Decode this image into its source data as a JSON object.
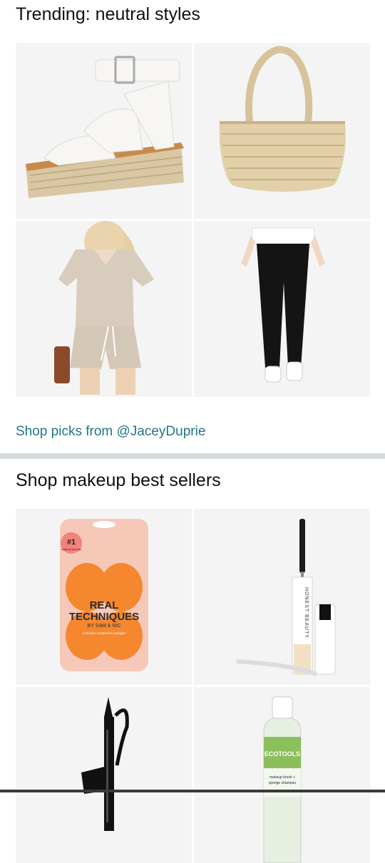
{
  "trending": {
    "title": "Trending: neutral styles",
    "tiles": [
      {
        "name": "White platform espadrille sandals"
      },
      {
        "name": "Woven straw tote bag"
      },
      {
        "name": "Beige waffle knit shorts set"
      },
      {
        "name": "Black leggings"
      }
    ],
    "link_text": "Shop picks from @JaceyDuprie"
  },
  "makeup": {
    "title": "Shop makeup best sellers",
    "tiles": [
      {
        "name": "Real Techniques makeup sponges",
        "badge": "#1",
        "badge_sub": "makeup sponge",
        "brand_line1": "REAL",
        "brand_line2": "TECHNIQUES",
        "brand_sub": "BY SAM & NIC",
        "pack_note": "4 miracle complexion sponges"
      },
      {
        "name": "Honest Beauty mascara",
        "brand": "HONEST BEAUTY"
      },
      {
        "name": "Black liquid eyeliner"
      },
      {
        "name": "EcoTools makeup brush shampoo",
        "brand": "ECOTOOLS",
        "label_line1": "makeup brush +",
        "label_line2": "sponge shampoo"
      }
    ]
  },
  "colors": {
    "link": "#227587",
    "divider": "#d5dbdb",
    "tile_bg": "#f4f4f5"
  }
}
